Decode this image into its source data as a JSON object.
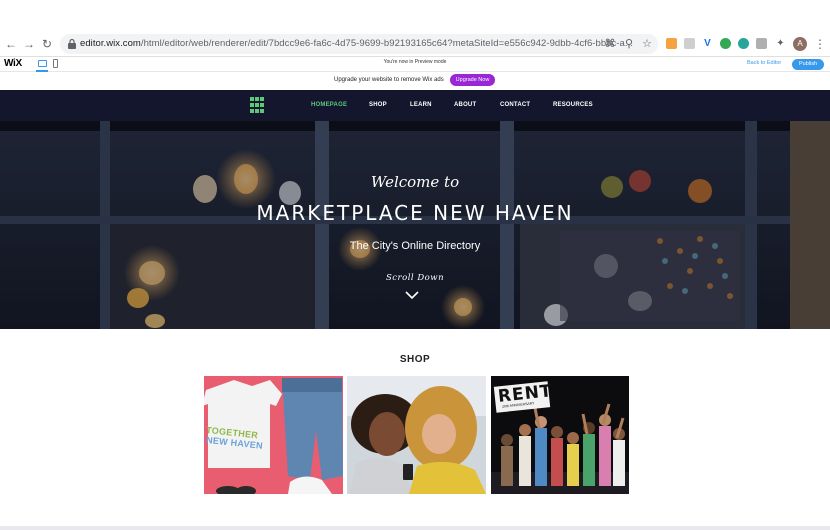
{
  "browser": {
    "url_host": "editor.wix.com",
    "url_path": "/html/editor/web/renderer/edit/7bdcc9e6-fa6c-4d75-9699-b92193165c64?metaSiteId=e556c942-9dbb-4cf6-bb6c-a...",
    "avatar_letter": "A"
  },
  "wix_bar": {
    "logo": "WiX",
    "back_to_editor": "Back to Editor",
    "publish": "Publish"
  },
  "preview_notice": "You're now in Preview mode",
  "upgrade": {
    "text": "Upgrade your website to remove Wix ads",
    "button": "Upgrade Now",
    "button_color": "#9a27d5"
  },
  "site_nav": {
    "items": [
      {
        "label": "HOMEPAGE",
        "active": true
      },
      {
        "label": "SHOP",
        "active": false
      },
      {
        "label": "LEARN",
        "active": false
      },
      {
        "label": "ABOUT",
        "active": false
      },
      {
        "label": "CONTACT",
        "active": false
      },
      {
        "label": "RESOURCES",
        "active": false
      }
    ],
    "accent": "#5fc77a",
    "background": "#14162e"
  },
  "hero": {
    "welcome": "Welcome to",
    "title": "MARKETPLACE NEW HAVEN",
    "subtitle": "The City's Online Directory",
    "scroll": "Scroll Down"
  },
  "shop": {
    "heading": "SHOP",
    "cards": [
      {
        "shirt_text_1": "TOGETHER",
        "shirt_text_2": "NEW HAVEN"
      },
      {},
      {
        "sign_text": "RENT",
        "sign_sub": "20th ANNIVERSARY"
      }
    ]
  }
}
